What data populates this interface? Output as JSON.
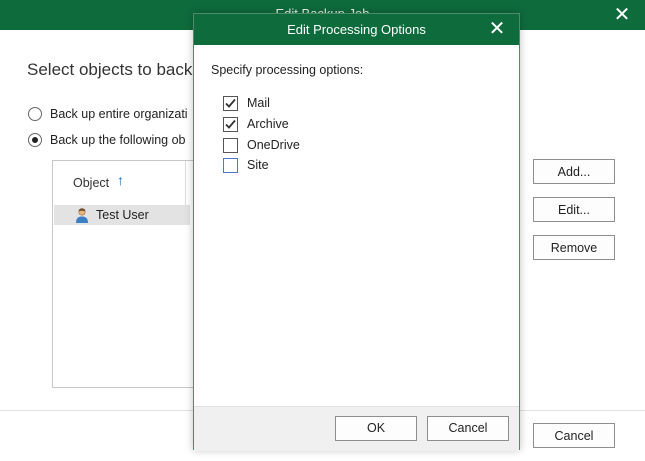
{
  "background_window": {
    "title": "Edit Backup Job",
    "heading": "Select objects to back",
    "radio_options": [
      {
        "label": "Back up entire organizati",
        "checked": false
      },
      {
        "label": "Back up the following ob",
        "checked": true
      }
    ],
    "table": {
      "column_header": "Object",
      "rows": [
        {
          "name": "Test User",
          "icon": "user-icon"
        }
      ]
    },
    "buttons": {
      "add": "Add...",
      "edit": "Edit...",
      "remove": "Remove",
      "cancel": "Cancel"
    }
  },
  "dialog": {
    "title": "Edit Processing Options",
    "prompt": "Specify processing options:",
    "options": [
      {
        "label": "Mail",
        "checked": true
      },
      {
        "label": "Archive",
        "checked": true
      },
      {
        "label": "OneDrive",
        "checked": false
      },
      {
        "label": "Site",
        "checked": false
      }
    ],
    "ok_label": "OK",
    "cancel_label": "Cancel"
  },
  "colors": {
    "titlebar": "#0e6b3c",
    "focus": "#4a79c9"
  }
}
